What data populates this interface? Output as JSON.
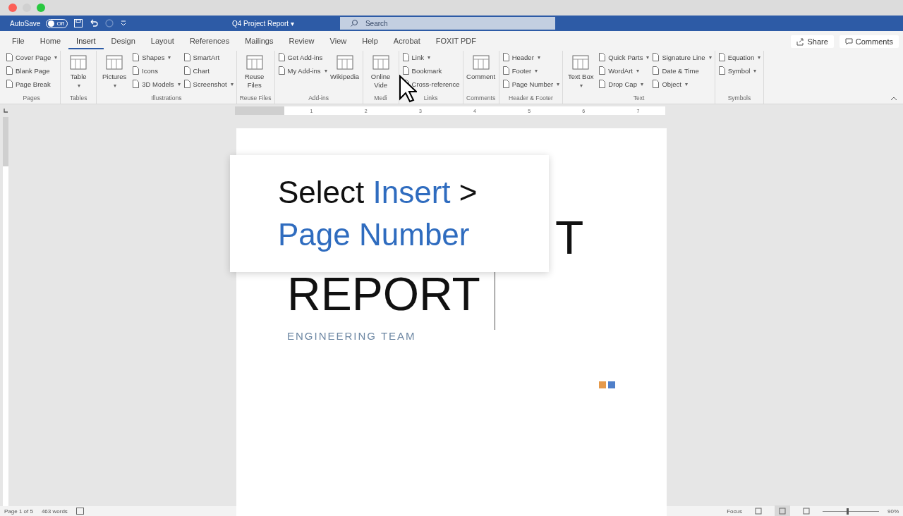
{
  "titlebar": {
    "autosave": {
      "label": "AutoSave",
      "on": false,
      "state_text": "Off"
    },
    "document_title": "Q4 Project Report",
    "title_caret": "▾",
    "search": {
      "placeholder": "Search"
    }
  },
  "tabs": [
    {
      "label": "File",
      "selected": false
    },
    {
      "label": "Home",
      "selected": false
    },
    {
      "label": "Insert",
      "selected": true
    },
    {
      "label": "Design",
      "selected": false
    },
    {
      "label": "Layout",
      "selected": false
    },
    {
      "label": "References",
      "selected": false
    },
    {
      "label": "Mailings",
      "selected": false
    },
    {
      "label": "Review",
      "selected": false
    },
    {
      "label": "View",
      "selected": false
    },
    {
      "label": "Help",
      "selected": false
    },
    {
      "label": "Acrobat",
      "selected": false
    },
    {
      "label": "FOXIT PDF",
      "selected": false
    }
  ],
  "tab_actions": [
    {
      "label": "Share",
      "kind": "share"
    },
    {
      "label": "Comments",
      "kind": "comments"
    }
  ],
  "ribbon": [
    {
      "name": "Pages",
      "columns": [
        {
          "kind": "stack",
          "items": [
            {
              "label": "Cover Page",
              "caret": "▾"
            },
            {
              "label": "Blank Page"
            },
            {
              "label": "Page Break"
            }
          ]
        }
      ]
    },
    {
      "name": "Tables",
      "columns": [
        {
          "kind": "large",
          "label": "Table",
          "caret": "▾"
        }
      ]
    },
    {
      "name": "Illustrations",
      "columns": [
        {
          "kind": "large",
          "label": "Pictures",
          "caret": "▾"
        },
        {
          "kind": "stack",
          "items": [
            {
              "label": "Shapes",
              "caret": "▾"
            },
            {
              "label": "Icons"
            },
            {
              "label": "3D Models",
              "caret": "▾"
            }
          ]
        },
        {
          "kind": "stack",
          "items": [
            {
              "label": "SmartArt"
            },
            {
              "label": "Chart"
            },
            {
              "label": "Screenshot",
              "caret": "▾"
            }
          ]
        }
      ]
    },
    {
      "name": "Reuse Files",
      "columns": [
        {
          "kind": "large",
          "label": "Reuse Files"
        }
      ]
    },
    {
      "name": "Add-ins",
      "columns": [
        {
          "kind": "stack",
          "items": [
            {
              "label": "Get Add-ins"
            },
            {
              "label": "My Add-ins",
              "caret": "▾"
            }
          ]
        },
        {
          "kind": "large",
          "label": "Wikipedia"
        }
      ]
    },
    {
      "name": "Medi",
      "columns": [
        {
          "kind": "large",
          "label": "Online Vide"
        }
      ]
    },
    {
      "name": "Links",
      "columns": [
        {
          "kind": "stack",
          "items": [
            {
              "label": "Link",
              "caret": "▾"
            },
            {
              "label": "Bookmark"
            },
            {
              "label": "Cross-reference"
            }
          ]
        }
      ]
    },
    {
      "name": "Comments",
      "columns": [
        {
          "kind": "large",
          "label": "Comment"
        }
      ]
    },
    {
      "name": "Header & Footer",
      "columns": [
        {
          "kind": "stack",
          "items": [
            {
              "label": "Header",
              "caret": "▾"
            },
            {
              "label": "Footer",
              "caret": "▾"
            },
            {
              "label": "Page Number",
              "caret": "▾"
            }
          ]
        }
      ]
    },
    {
      "name": "Text",
      "columns": [
        {
          "kind": "large",
          "label": "Text Box",
          "caret": "▾"
        },
        {
          "kind": "stack",
          "items": [
            {
              "label": "Quick Parts",
              "caret": "▾"
            },
            {
              "label": "WordArt",
              "caret": "▾"
            },
            {
              "label": "Drop Cap",
              "caret": "▾"
            }
          ]
        },
        {
          "kind": "stack",
          "items": [
            {
              "label": "Signature Line",
              "caret": "▾"
            },
            {
              "label": "Date & Time"
            },
            {
              "label": "Object",
              "caret": "▾"
            }
          ]
        }
      ]
    },
    {
      "name": "Symbols",
      "columns": [
        {
          "kind": "stack",
          "items": [
            {
              "label": "Equation",
              "caret": "▾"
            },
            {
              "label": "Symbol",
              "caret": "▾"
            }
          ]
        }
      ]
    }
  ],
  "ruler": {
    "numbers": [
      "1",
      "2",
      "3",
      "4",
      "5",
      "6",
      "7"
    ]
  },
  "callout": {
    "lines": [
      [
        {
          "text": "Select",
          "highlight": false
        },
        {
          "text": "Insert",
          "highlight": true
        },
        {
          "text": ">",
          "highlight": false
        }
      ],
      [
        {
          "text": "Page Number",
          "highlight": true
        }
      ]
    ]
  },
  "document": {
    "title_visible": "T",
    "title_line_2": "REPORT",
    "subtitle": "ENGINEERING TEAM",
    "accent_squares": [
      {
        "color": "#e59a4c"
      },
      {
        "color": "#4f7fc9"
      }
    ]
  },
  "status_bar": {
    "page": "Page 1 of 5",
    "words": "463 words",
    "focus": "Focus",
    "views": [
      {
        "selected": false
      },
      {
        "selected": true
      },
      {
        "selected": false
      }
    ],
    "zoom": {
      "level": 0.42
    },
    "zoom_text": "90%"
  }
}
